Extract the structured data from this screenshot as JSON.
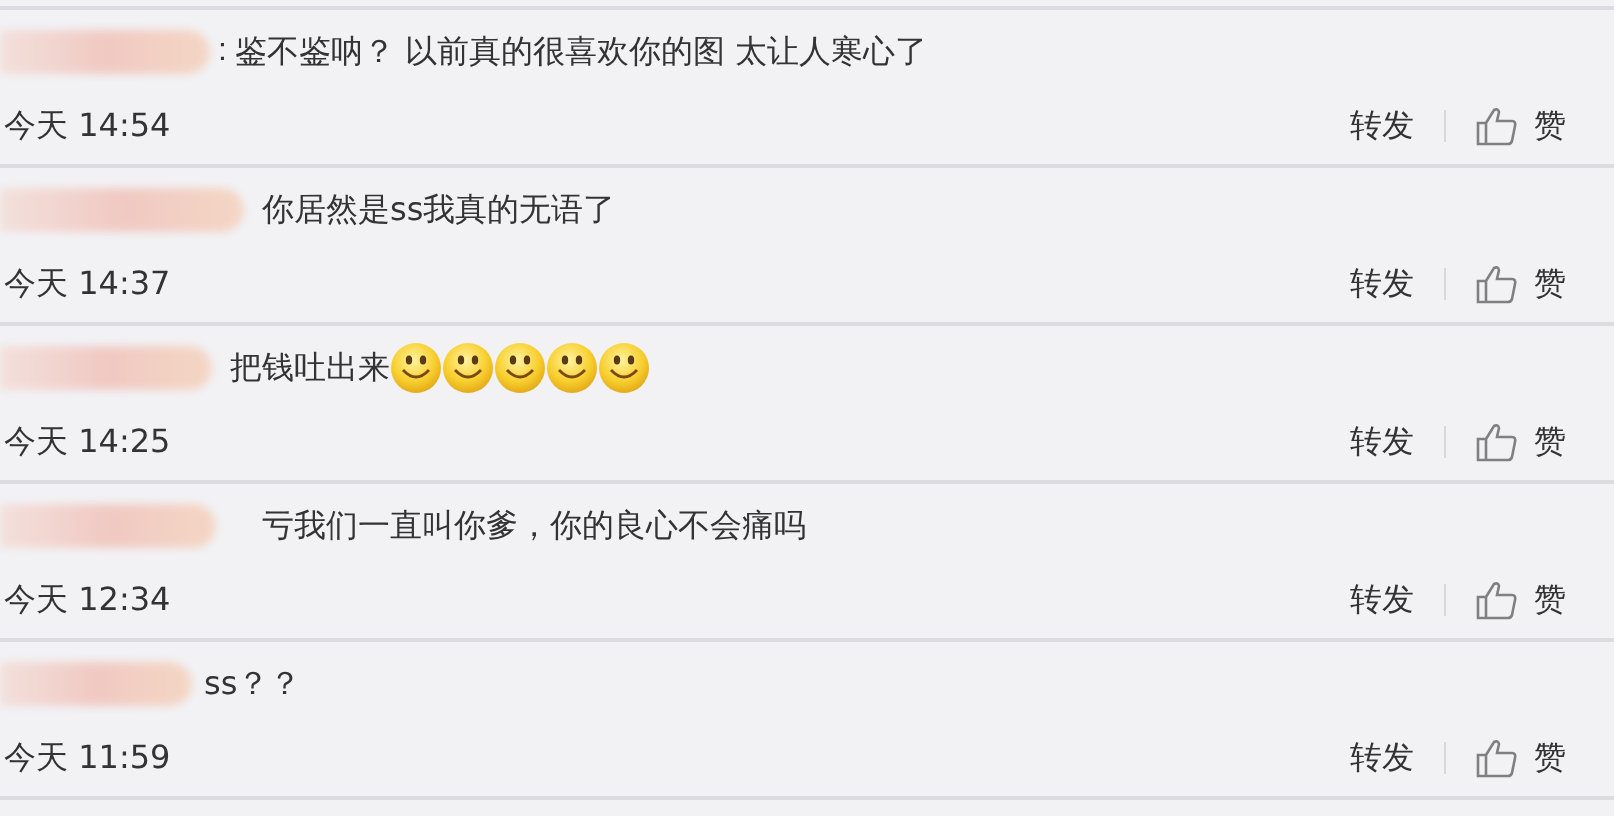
{
  "comments": [
    {
      "separator": ":",
      "text": "鉴不鉴呐？ 以前真的很喜欢你的图 太让人寒心了",
      "time": "今天 14:54",
      "repost": "转发",
      "like": "赞"
    },
    {
      "text": "你居然是ss我真的无语了",
      "time": "今天 14:37",
      "repost": "转发",
      "like": "赞"
    },
    {
      "text": "把钱吐出来",
      "emojis": [
        {
          "kind": "smile"
        },
        {
          "kind": "smile"
        },
        {
          "kind": "smile"
        },
        {
          "kind": "smile"
        },
        {
          "kind": "smile"
        }
      ],
      "time": "今天 14:25",
      "repost": "转发",
      "like": "赞"
    },
    {
      "text": "亏我们一直叫你爹，你的良心不会痛吗",
      "time": "今天 12:34",
      "repost": "转发",
      "like": "赞"
    },
    {
      "text": "ss？？",
      "time": "今天 11:59",
      "repost": "转发",
      "like": "赞"
    }
  ]
}
